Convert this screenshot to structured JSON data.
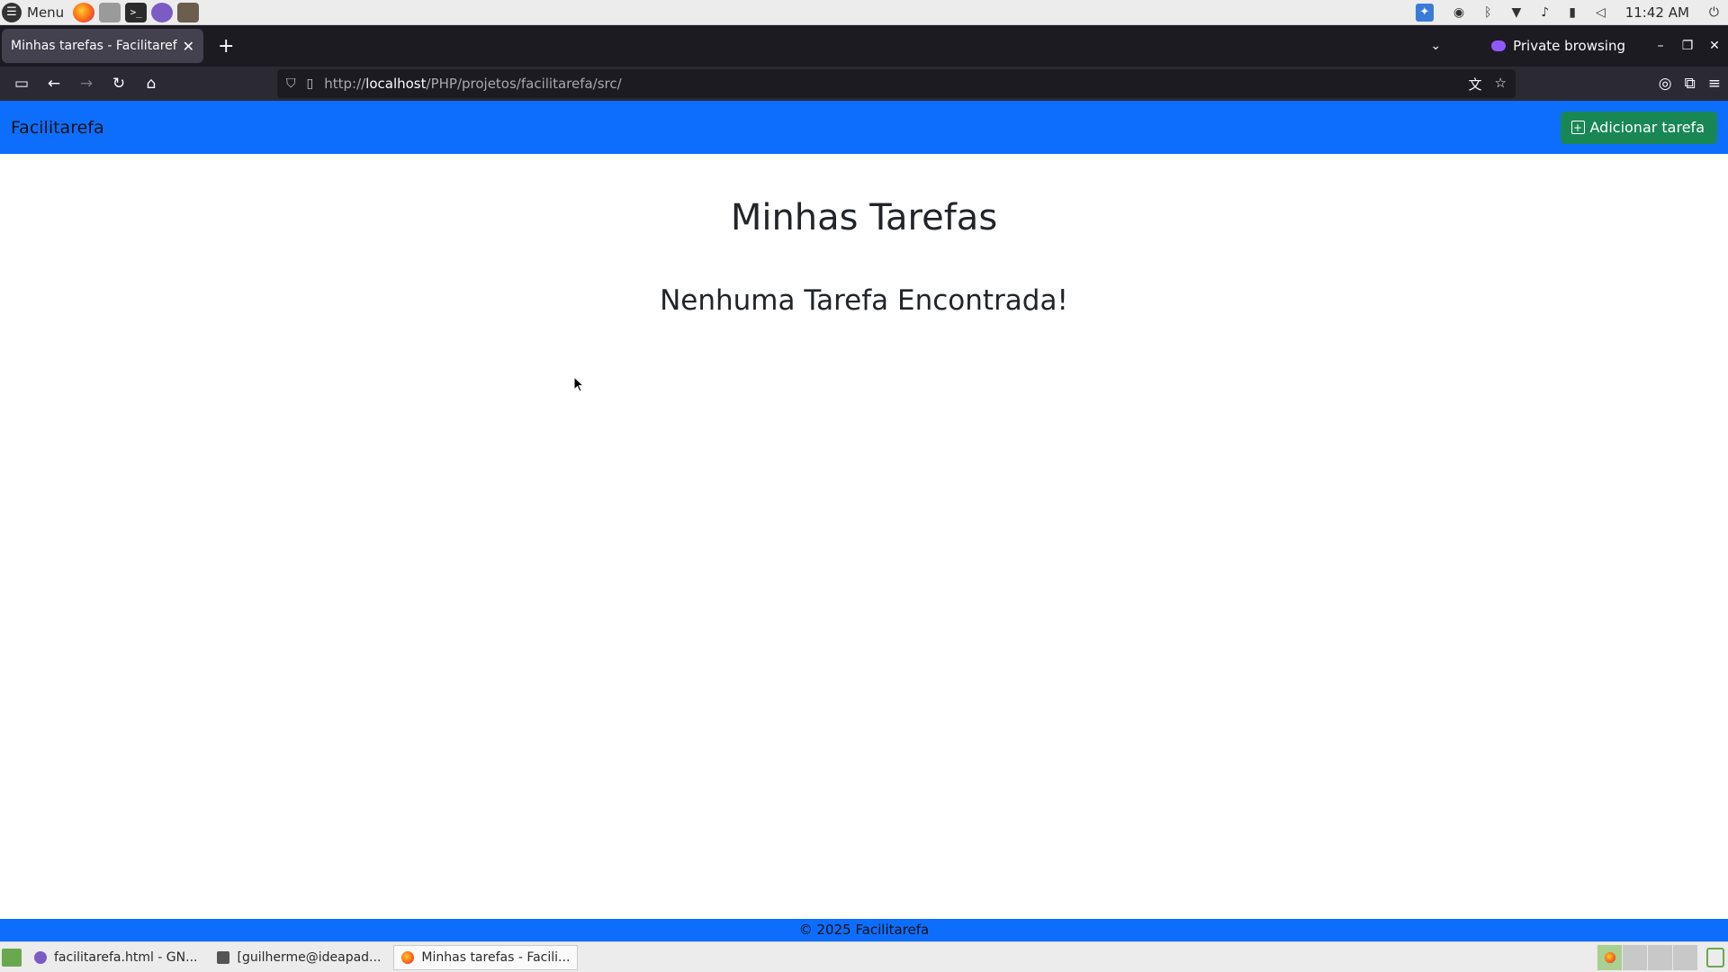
{
  "system_panel": {
    "menu_label": "Menu",
    "clock": "11:42 AM"
  },
  "browser": {
    "tab_title": "Minhas tarefas - Facilitarefa",
    "private_label": "Private browsing",
    "url_host": "localhost",
    "url_prefix": "http://",
    "url_path": "/PHP/projetos/facilitarefa/src/"
  },
  "app": {
    "brand": "Facilitarefa",
    "add_task_label": "Adicionar tarefa",
    "page_title": "Minhas Tarefas",
    "empty_message": "Nenhuma Tarefa Encontrada!",
    "footer": "© 2025 Facilitarefa"
  },
  "taskbar": {
    "items": [
      {
        "label": "facilitarefa.html - GN..."
      },
      {
        "label": "[guilherme@ideapad..."
      },
      {
        "label": "Minhas tarefas - Facili..."
      }
    ]
  },
  "colors": {
    "header_blue": "#0d6efd",
    "success_green": "#198754",
    "browser_dark": "#1c1b22"
  }
}
